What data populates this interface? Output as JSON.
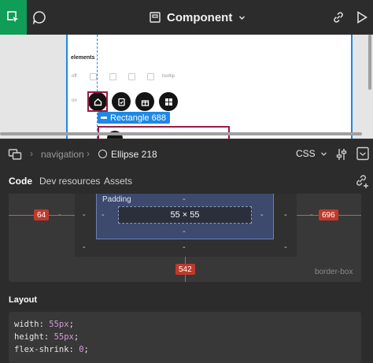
{
  "toolbar": {
    "title": "Component",
    "move_tool": "move-tool",
    "comment_tool": "comment-tool",
    "colors": {
      "accent": "#0f9d58"
    }
  },
  "canvas": {
    "section_label": "elements",
    "row_off_label": "off",
    "row_on_label": "on",
    "small_label": "tooltip",
    "selection_tag": "Rectangle 688",
    "icons": [
      "home-icon",
      "clipboard-icon",
      "gift-icon",
      "grid-icon"
    ]
  },
  "breadcrumb": {
    "parent": "navigation",
    "current": "Ellipse 218",
    "language": "CSS"
  },
  "tabs": [
    {
      "label": "Code",
      "active": true
    },
    {
      "label": "Dev resources",
      "active": false
    },
    {
      "label": "Assets",
      "active": false
    }
  ],
  "box_model": {
    "padding_label": "Padding",
    "content_size": "55 × 55",
    "left_offset": "64",
    "right_offset": "696",
    "bottom_offset": "542",
    "dash": "-",
    "border_box_label": "border-box"
  },
  "layout": {
    "heading": "Layout",
    "css": [
      {
        "prop": "width: ",
        "val": "55px",
        "end": ";"
      },
      {
        "prop": "height: ",
        "val": "55px",
        "end": ";"
      },
      {
        "prop": "flex-shrink: ",
        "val": "0",
        "end": ";"
      }
    ]
  }
}
